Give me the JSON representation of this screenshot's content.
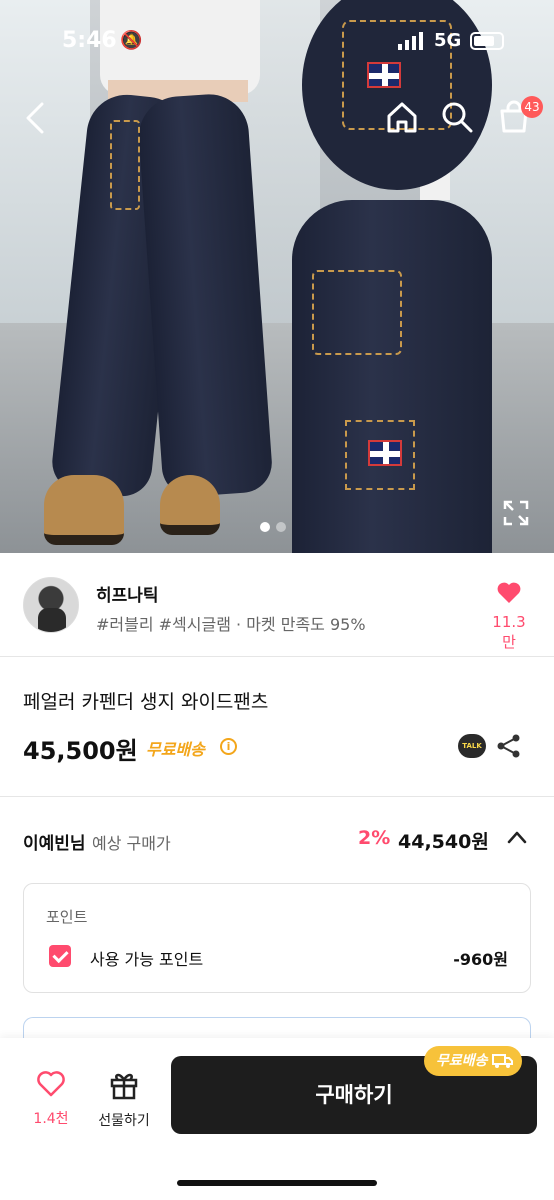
{
  "status": {
    "time": "5:46",
    "network": "5G"
  },
  "nav": {
    "cart_count": "43"
  },
  "shop": {
    "name": "히프나틱",
    "tags": "#러블리 #섹시글램 · 마켓 만족도 95%",
    "likes": "11.3만"
  },
  "product": {
    "title": "페얼러 카펜더 생지 와이드팬츠",
    "price": "45,500원",
    "shipping": "무료배송",
    "talk_label": "TALK"
  },
  "expected": {
    "user": "이예빈님",
    "label": "예상 구매가",
    "discount": "2%",
    "price": "44,540원"
  },
  "points": {
    "header": "포인트",
    "label": "사용 가능 포인트",
    "amount": "-960원",
    "checked": true
  },
  "bottom_bar": {
    "like_count": "1.4천",
    "gift_label": "선물하기",
    "buy_label": "구매하기",
    "free_shipping_badge": "무료배송"
  },
  "carousel": {
    "total": 2,
    "active": 1
  },
  "colors": {
    "accent_pink": "#ff4b6e",
    "accent_orange": "#f3a61b",
    "buy_button": "#1d1d1d"
  }
}
